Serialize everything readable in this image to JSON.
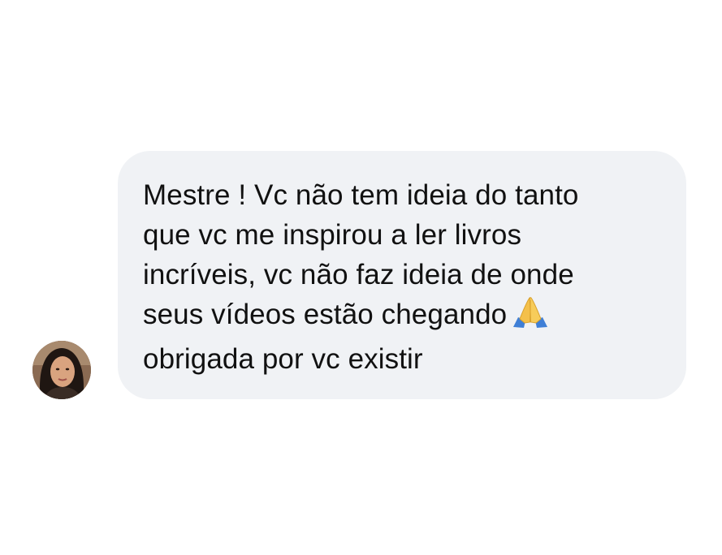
{
  "message": {
    "lines": [
      "Mestre ! Vc não tem ideia do tanto",
      "que vc me inspirou a ler livros",
      "incríveis, vc não faz ideia de onde",
      "seus vídeos estão chegando",
      "obrigada por vc existir"
    ],
    "emoji": "folded-hands-emoji"
  },
  "colors": {
    "bubble_background": "#f0f2f5",
    "text": "#111111",
    "page_background": "#ffffff"
  },
  "icons": {
    "avatar": "user-avatar-photo",
    "emoji": "folded-hands-emoji"
  }
}
